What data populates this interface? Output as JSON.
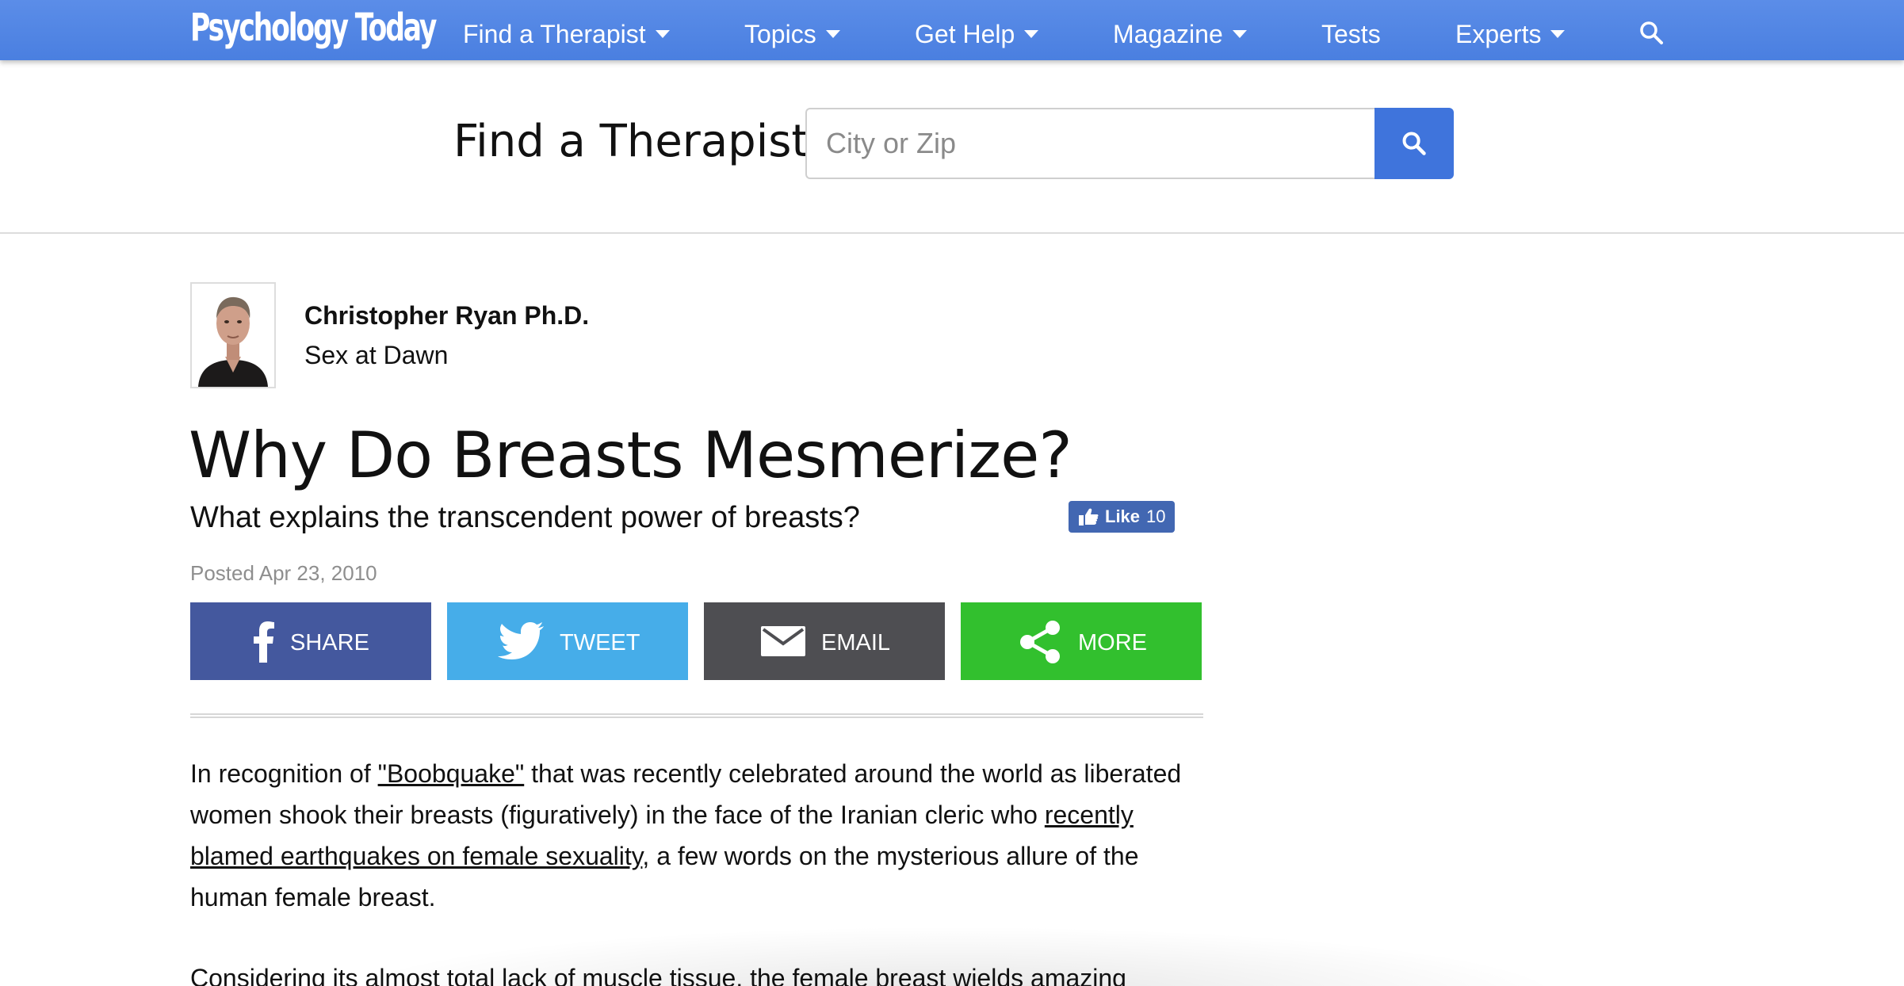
{
  "nav": {
    "logo": "Psychology Today",
    "items": [
      {
        "label": "Find a Therapist",
        "dropdown": true
      },
      {
        "label": "Topics",
        "dropdown": true
      },
      {
        "label": "Get Help",
        "dropdown": true
      },
      {
        "label": "Magazine",
        "dropdown": true
      },
      {
        "label": "Tests",
        "dropdown": false
      },
      {
        "label": "Experts",
        "dropdown": true
      }
    ],
    "search_icon": "search-icon"
  },
  "find_therapist": {
    "title": "Find a Therapist",
    "placeholder": "City or Zip",
    "value": "",
    "button_icon": "search-icon"
  },
  "author": {
    "name": "Christopher Ryan Ph.D.",
    "blog": "Sex at Dawn"
  },
  "article": {
    "title": "Why Do Breasts Mesmerize?",
    "subtitle": "What explains the transcendent power of breasts?",
    "like_label": "Like",
    "like_count": "10",
    "posted": "Posted Apr 23, 2010",
    "share": {
      "facebook": "SHARE",
      "twitter": "TWEET",
      "email": "EMAIL",
      "more": "MORE"
    },
    "para1": {
      "t1": "In recognition of ",
      "link1": "\"Boobquake\"",
      "t2": " that was recently celebrated around the world as liberated women shook their breasts (figuratively) in the face of the Iranian cleric who ",
      "link2": "recently blamed earthquakes on female sexuality",
      "t3": ", a few words on the mysterious allure of the human female breast."
    },
    "para2": "Considering its almost total lack of muscle tissue, the female breast wields amazing"
  },
  "colors": {
    "nav_bg": "#4a7fe0",
    "search_btn": "#3f74dc",
    "facebook": "#44589e",
    "twitter": "#46ade9",
    "email": "#4e4e52",
    "more": "#32c02e",
    "like": "#4267b2"
  }
}
